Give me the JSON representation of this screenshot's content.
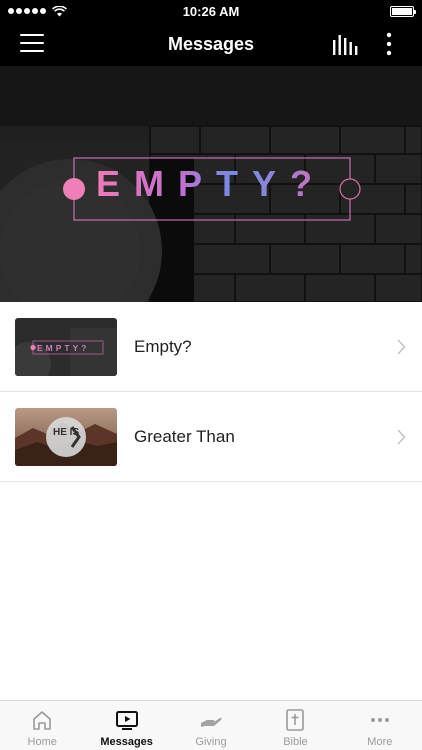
{
  "status_bar": {
    "time": "10:26 AM"
  },
  "nav": {
    "title": "Messages"
  },
  "hero": {
    "title": "EMPTY?"
  },
  "messages": [
    {
      "title": "Empty?",
      "thumb_text": "EMPTY?"
    },
    {
      "title": "Greater Than",
      "thumb_text": "HE IS"
    }
  ],
  "tabs": [
    {
      "label": "Home",
      "icon": "home-icon"
    },
    {
      "label": "Messages",
      "icon": "play-screen-icon",
      "active": true
    },
    {
      "label": "Giving",
      "icon": "hand-icon"
    },
    {
      "label": "Bible",
      "icon": "bible-icon"
    },
    {
      "label": "More",
      "icon": "dots-icon"
    }
  ],
  "colors": {
    "accent_pink": "#e96fb3",
    "accent_blue": "#6b8fe8",
    "nav_bg": "#000000"
  }
}
